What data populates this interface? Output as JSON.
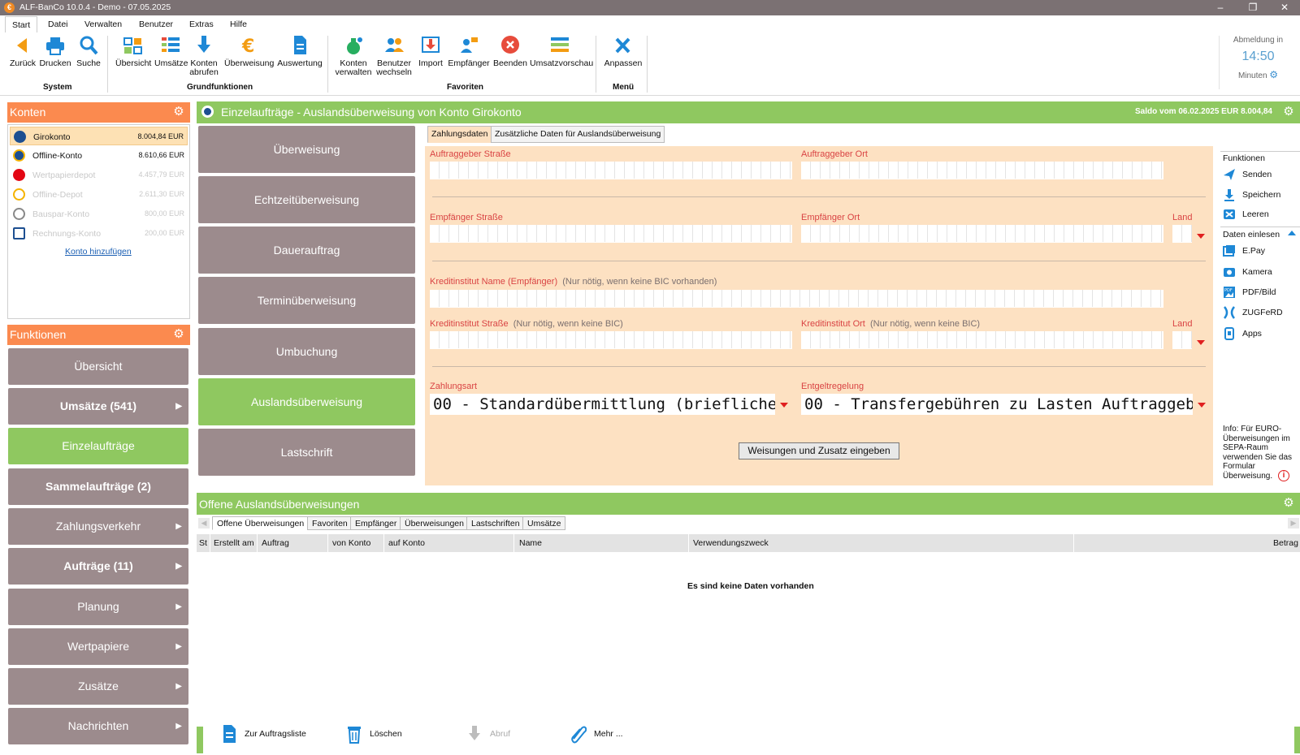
{
  "window": {
    "title": "ALF-BanCo 10.0.4 - Demo - 07.05.2025",
    "controls": [
      "minimize-icon",
      "restore-icon",
      "close-icon"
    ]
  },
  "menu": {
    "tabs": [
      "Start",
      "Datei",
      "Verwalten",
      "Benutzer",
      "Extras",
      "Hilfe"
    ]
  },
  "ribbon": {
    "groups": [
      {
        "label": "System"
      },
      {
        "label": "Grundfunktionen"
      },
      {
        "label": "Favoriten"
      },
      {
        "label": "Menü"
      }
    ],
    "buttons": [
      {
        "label": "Zurück",
        "icon": "back-arrow-icon"
      },
      {
        "label": "Drucken",
        "icon": "printer-icon"
      },
      {
        "label": "Suche",
        "icon": "search-icon"
      },
      {
        "label": "Übersicht",
        "icon": "overview-icon"
      },
      {
        "label": "Umsätze",
        "icon": "list-icon"
      },
      {
        "label": "Konten abrufen",
        "line1": "Konten",
        "line2": "abrufen",
        "icon": "download-icon"
      },
      {
        "label": "Überweisung",
        "icon": "euro-icon"
      },
      {
        "label": "Auswertung",
        "icon": "document-icon"
      },
      {
        "label": "Konten verwalten",
        "line1": "Konten",
        "line2": "verwalten",
        "icon": "money-bag-icon"
      },
      {
        "label": "Benutzer wechseln",
        "line1": "Benutzer",
        "line2": "wechseln",
        "icon": "users-icon"
      },
      {
        "label": "Import",
        "icon": "import-icon"
      },
      {
        "label": "Empfänger",
        "icon": "recipient-icon"
      },
      {
        "label": "Beenden",
        "icon": "exit-icon"
      },
      {
        "label": "Umsatzvorschau",
        "icon": "preview-icon"
      },
      {
        "label": "Anpassen",
        "icon": "tools-icon"
      }
    ]
  },
  "logout": {
    "label": "Abmeldung in",
    "time": "14:50",
    "unit": "Minuten"
  },
  "konten": {
    "title": "Konten",
    "items": [
      {
        "name": "Girokonto",
        "balance": "8.004,84 EUR",
        "color": "#1d4f91"
      },
      {
        "name": "Offline-Konto",
        "balance": "8.610,66 EUR",
        "color": "#1d4f91"
      },
      {
        "name": "Wertpapierdepot",
        "balance": "4.457,79 EUR",
        "color": "#e30613"
      },
      {
        "name": "Offline-Depot",
        "balance": "2.611,30 EUR",
        "color": "#f5b300"
      },
      {
        "name": "Bauspar-Konto",
        "balance": "800,00 EUR",
        "color": "#888888"
      },
      {
        "name": "Rechnungs-Konto",
        "balance": "200,00 EUR",
        "color": "#1d4f91"
      }
    ],
    "add_link": "Konto hinzufügen"
  },
  "funktionen": {
    "title": "Funktionen",
    "items": [
      {
        "label": "Übersicht",
        "bold": false,
        "arrow": false
      },
      {
        "label": "Umsätze (541)",
        "bold": true,
        "arrow": true
      },
      {
        "label": "Einzelaufträge",
        "bold": false,
        "arrow": false,
        "active": true
      },
      {
        "label": "Sammelaufträge (2)",
        "bold": true,
        "arrow": false
      },
      {
        "label": "Zahlungsverkehr",
        "bold": false,
        "arrow": true
      },
      {
        "label": "Aufträge (11)",
        "bold": true,
        "arrow": true
      },
      {
        "label": "Planung",
        "bold": false,
        "arrow": true
      },
      {
        "label": "Wertpapiere",
        "bold": false,
        "arrow": true
      },
      {
        "label": "Zusätze",
        "bold": false,
        "arrow": true
      },
      {
        "label": "Nachrichten",
        "bold": false,
        "arrow": true
      }
    ]
  },
  "main": {
    "title": "Einzelaufträge - Auslandsüberweisung von Konto Girokonto",
    "saldo": "Saldo vom 06.02.2025 EUR 8.004,84"
  },
  "order_types": [
    "Überweisung",
    "Echtzeitüberweisung",
    "Dauerauftrag",
    "Terminüberweisung",
    "Umbuchung",
    "Auslandsüberweisung",
    "Lastschrift"
  ],
  "form": {
    "tabs": [
      "Zahlungsdaten",
      "Zusätzliche Daten für Auslandsüberweisung"
    ],
    "auftraggeber_strasse": "Auftraggeber Straße",
    "auftraggeber_ort": "Auftraggeber Ort",
    "empfaenger_strasse": "Empfänger Straße",
    "empfaenger_ort": "Empfänger Ort",
    "land": "Land",
    "kreditinstitut_name": "Kreditinstitut Name (Empfänger)",
    "kreditinstitut_name_hint": "(Nur nötig, wenn keine BIC vorhanden)",
    "kreditinstitut_strasse": "Kreditinstitut Straße",
    "kreditinstitut_strasse_hint": "(Nur nötig, wenn keine BIC)",
    "kreditinstitut_ort": "Kreditinstitut Ort",
    "kreditinstitut_ort_hint": "(Nur nötig, wenn keine BIC)",
    "zahlungsart_label": "Zahlungsart",
    "zahlungsart_value": "00 - Standardübermittlung (briefliche",
    "entgelt_label": "Entgeltregelung",
    "entgelt_value": "00 - Transfergebühren zu Lasten Auftraggeb",
    "weisungen_button": "Weisungen und Zusatz eingeben"
  },
  "right_panel": {
    "funktionen_title": "Funktionen",
    "funktionen": [
      {
        "label": "Senden",
        "icon": "send-icon"
      },
      {
        "label": "Speichern",
        "icon": "save-icon"
      },
      {
        "label": "Leeren",
        "icon": "clear-icon"
      }
    ],
    "daten_title": "Daten einlesen",
    "daten": [
      {
        "label": "E.Pay",
        "icon": "epay-icon"
      },
      {
        "label": "Kamera",
        "icon": "camera-icon"
      },
      {
        "label": "PDF/Bild",
        "icon": "pdf-icon"
      },
      {
        "label": "ZUGFeRD",
        "icon": "zugferd-icon"
      },
      {
        "label": "Apps",
        "icon": "apps-icon"
      }
    ],
    "info_lines": [
      "Info: Für EURO-",
      "Überweisungen im",
      "SEPA-Raum",
      "verwenden Sie das",
      "Formular",
      "Überweisung."
    ]
  },
  "table": {
    "title": "Offene Auslandsüberweisungen",
    "tabs": [
      "Offene Überweisungen",
      "Favoriten",
      "Empfänger",
      "Überweisungen",
      "Lastschriften",
      "Umsätze"
    ],
    "columns": [
      "St",
      "Erstellt am",
      "Auftrag",
      "von Konto",
      "auf Konto",
      "Name",
      "Verwendungszweck",
      "Betrag"
    ],
    "empty_text": "Es sind keine Daten vorhanden"
  },
  "bottom_buttons": [
    {
      "label": "Zur Auftragsliste",
      "icon": "list-document-icon",
      "enabled": true
    },
    {
      "label": "Löschen",
      "icon": "trash-icon",
      "enabled": true
    },
    {
      "label": "Abruf",
      "icon": "download-icon",
      "enabled": false
    },
    {
      "label": "Mehr ...",
      "icon": "paperclip-icon",
      "enabled": true
    }
  ],
  "colors": {
    "orange": "#fb8a4f",
    "green": "#8fc860",
    "button_gray": "#9c8b8d",
    "form_bg": "#fde1c2",
    "label_red": "#d94343"
  }
}
